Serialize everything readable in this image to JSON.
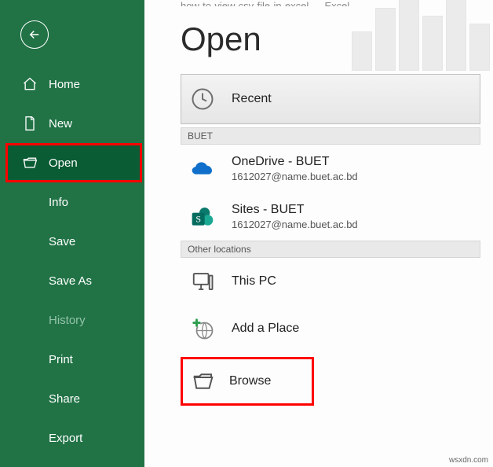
{
  "crumb": "how-to-view-csv-file-in-excel — Excel",
  "page_title": "Open",
  "sidebar": {
    "home": "Home",
    "new": "New",
    "open": "Open",
    "info": "Info",
    "save": "Save",
    "save_as": "Save As",
    "history": "History",
    "print": "Print",
    "share": "Share",
    "export": "Export"
  },
  "sections": {
    "recent": "Recent",
    "group1_header": "BUET",
    "onedrive_title": "OneDrive - BUET",
    "onedrive_sub": "1612027@name.buet.ac.bd",
    "sites_title": "Sites - BUET",
    "sites_sub": "1612027@name.buet.ac.bd",
    "other_header": "Other locations",
    "thispc": "This PC",
    "addplace": "Add a Place",
    "browse": "Browse"
  },
  "watermark": "wsxdn.com"
}
